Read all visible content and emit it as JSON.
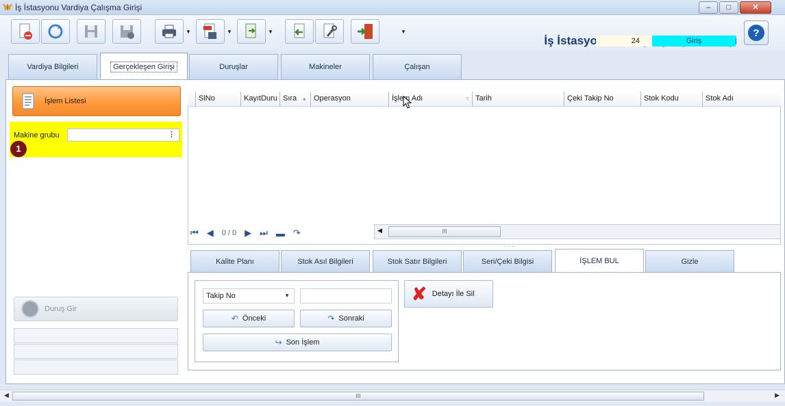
{
  "window": {
    "title": "İş İstasyonu Vardiya Çalışma Girişi",
    "controls": [
      "minimize",
      "maximize",
      "close"
    ]
  },
  "header": {
    "app_title": "İş İstasyonu Vardiya Çalışma Girişi",
    "shift_no": "24",
    "mode": "Giriş"
  },
  "toolbar": {
    "buttons": [
      "new-document-icon",
      "refresh-icon",
      "save-icon",
      "save-delete-icon",
      "print-icon",
      "pdf-icon",
      "export-icon",
      "back-icon",
      "settings-icon",
      "exit-door-icon"
    ]
  },
  "tabs": [
    {
      "label": "Vardiya Bilgileri"
    },
    {
      "label": "Gerçekleşen Girişi"
    },
    {
      "label": "Duruşlar"
    },
    {
      "label": "Makineler"
    },
    {
      "label": "Çalışan"
    }
  ],
  "left": {
    "islem_listesi": "İşlem Listesi",
    "makine_grubu_label": "Makine grubu",
    "makine_grubu_value": "",
    "badge": "1",
    "durus_gir": "Duruş Gir"
  },
  "grid": {
    "columns": [
      "SlNo",
      "KayıtDuru",
      "Sıra",
      "Operasyon",
      "İşlem Adı",
      "Tarih",
      "Çeki Takip No",
      "Stok Kodu",
      "Stok Adı"
    ],
    "pager": "0 / 0",
    "scroll_thumb": "III"
  },
  "bottom_tabs": [
    {
      "label": "Kalite Planı"
    },
    {
      "label": "Stok Asıl Bilgileri"
    },
    {
      "label": "Stok Satır Bilgileri"
    },
    {
      "label": "Seri/Çeki Bilgisi"
    },
    {
      "label": "İŞLEM BUL"
    },
    {
      "label": "Gizle"
    }
  ],
  "search": {
    "field_combo": "Takip No",
    "value": "",
    "prev": "Önceki",
    "next": "Sonraki",
    "last": "Son İşlem",
    "delete": "Detayı İle Sil"
  },
  "colors": {
    "accent_orange": "#ff9a3c",
    "highlight_yellow": "#ffff00",
    "mode_cyan": "#00f2ff",
    "badge_red": "#7a1414"
  }
}
